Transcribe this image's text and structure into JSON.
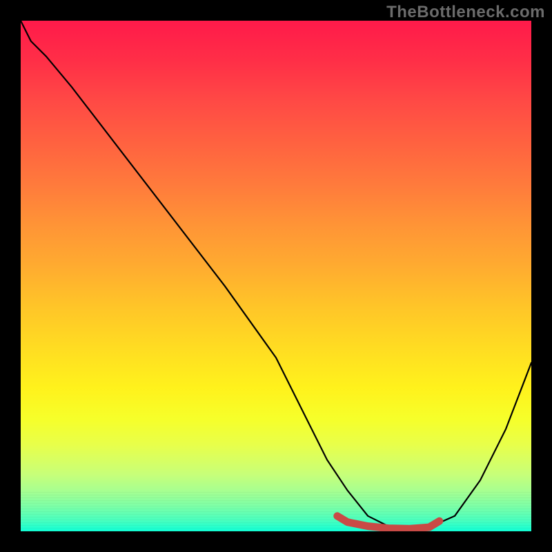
{
  "watermark": "TheBottleneck.com",
  "chart_data": {
    "type": "line",
    "title": "",
    "xlabel": "",
    "ylabel": "",
    "xlim": [
      0,
      100
    ],
    "ylim": [
      0,
      100
    ],
    "grid": false,
    "legend": false,
    "series": [
      {
        "name": "bottleneck-curve",
        "color": "#000000",
        "x": [
          0,
          2,
          5,
          10,
          20,
          30,
          40,
          50,
          56,
          60,
          64,
          68,
          72,
          76,
          80,
          85,
          90,
          95,
          100
        ],
        "y": [
          100,
          96,
          93,
          87,
          74,
          61,
          48,
          34,
          22,
          14,
          8,
          3,
          1,
          0.5,
          0.8,
          3,
          10,
          20,
          33
        ]
      },
      {
        "name": "optimal-range-marker",
        "color": "#d64a47",
        "x": [
          62,
          64,
          68,
          72,
          76,
          80,
          82
        ],
        "y": [
          3,
          1.8,
          1,
          0.6,
          0.5,
          0.8,
          2
        ]
      }
    ],
    "annotations": [],
    "background_gradient": {
      "stops": [
        {
          "pos": 0,
          "color": "#ff1a4a"
        },
        {
          "pos": 50,
          "color": "#ffb82a"
        },
        {
          "pos": 80,
          "color": "#f6ff2a"
        },
        {
          "pos": 100,
          "color": "#10ffd6"
        }
      ]
    }
  }
}
